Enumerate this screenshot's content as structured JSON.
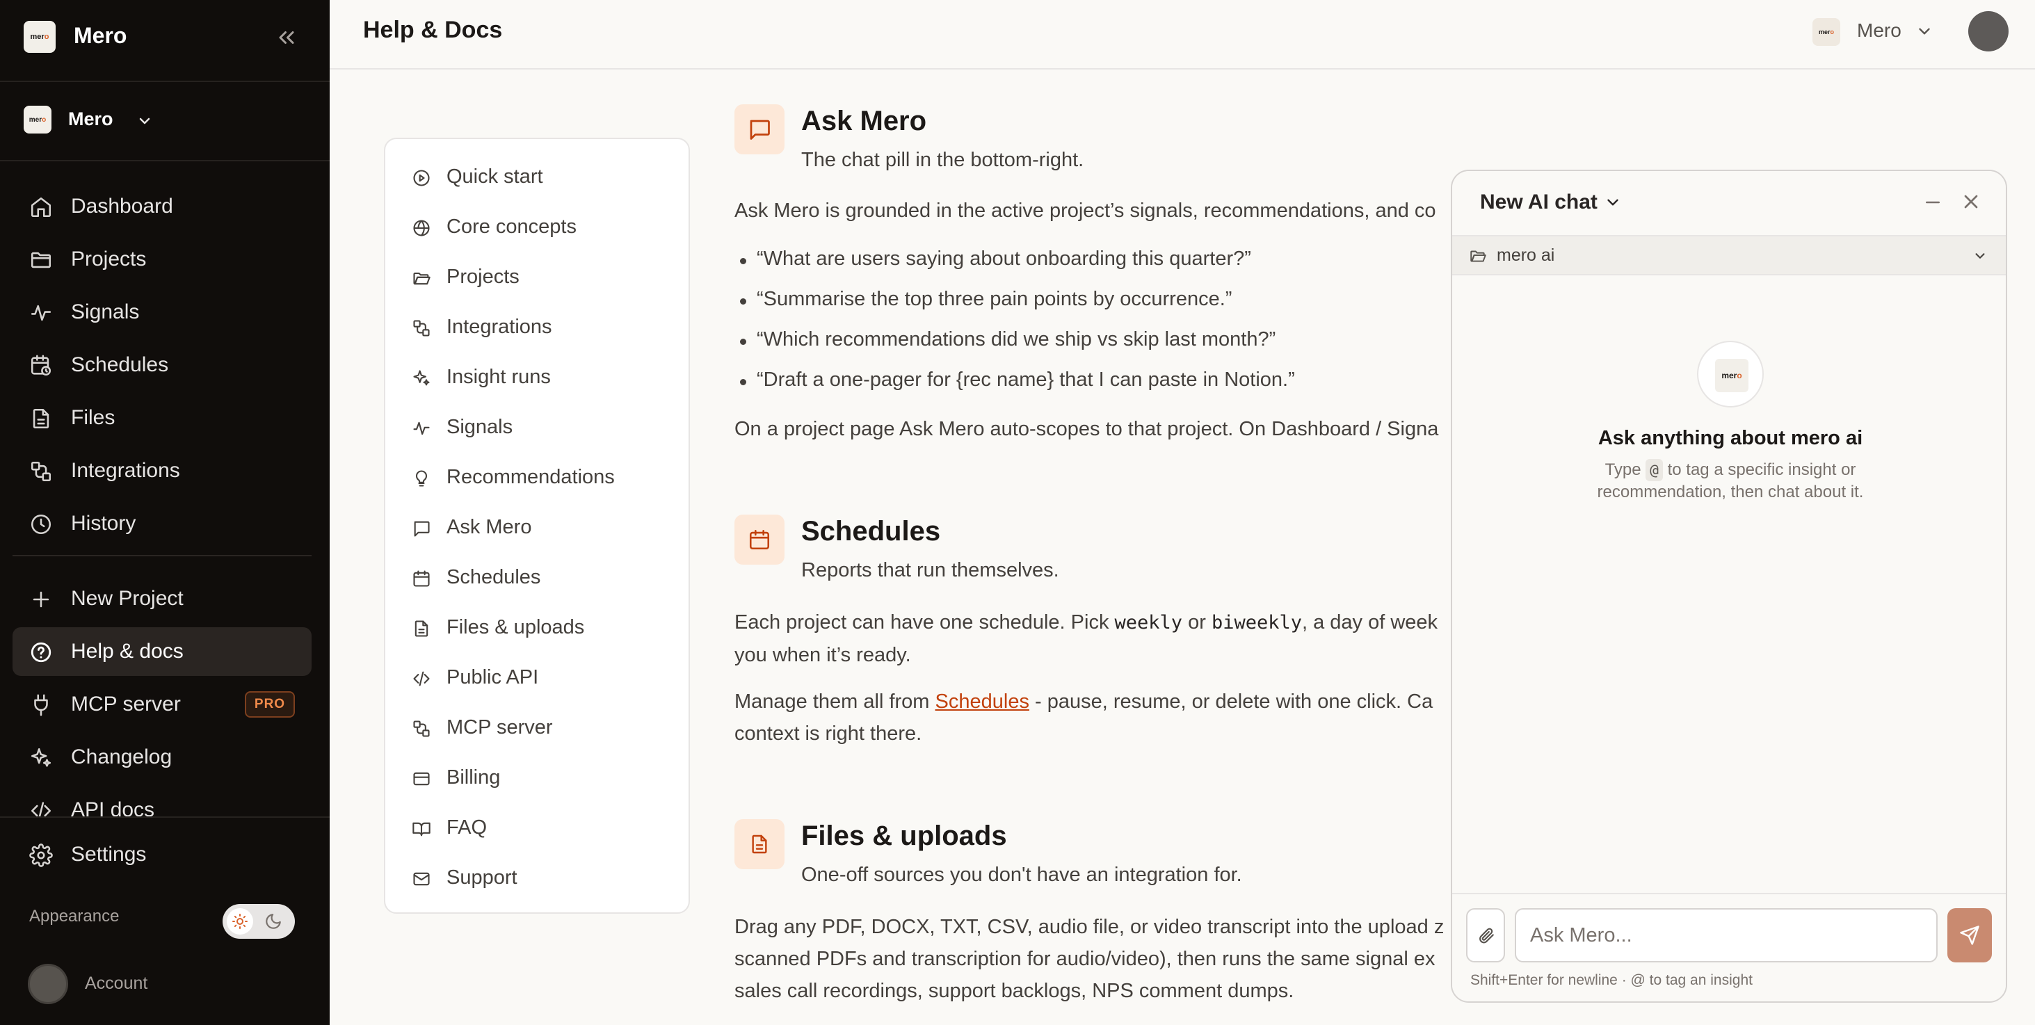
{
  "sidebar": {
    "app_title": "Mero",
    "logo_text_a": "mer",
    "logo_text_b": "o",
    "workspace": "Mero",
    "nav": [
      {
        "label": "Dashboard",
        "icon": "home-icon"
      },
      {
        "label": "Projects",
        "icon": "folder-icon"
      },
      {
        "label": "Signals",
        "icon": "activity-icon"
      },
      {
        "label": "Schedules",
        "icon": "calendar-clock-icon"
      },
      {
        "label": "Files",
        "icon": "file-icon"
      },
      {
        "label": "Integrations",
        "icon": "plug-icon"
      },
      {
        "label": "History",
        "icon": "clock-icon"
      }
    ],
    "nav2": [
      {
        "label": "New Project",
        "icon": "plus-icon"
      },
      {
        "label": "Help & docs",
        "icon": "help-circle-icon",
        "active": true
      },
      {
        "label": "MCP server",
        "icon": "plug-icon",
        "badge": "PRO"
      },
      {
        "label": "Changelog",
        "icon": "sparkles-icon"
      },
      {
        "label": "API docs",
        "icon": "code-icon"
      }
    ],
    "settings": "Settings",
    "appearance": "Appearance",
    "account": "Account"
  },
  "header": {
    "title": "Help & Docs",
    "workspace": "Mero"
  },
  "toc": [
    {
      "label": "Quick start",
      "icon": "play-circle-icon"
    },
    {
      "label": "Core concepts",
      "icon": "globe-icon"
    },
    {
      "label": "Projects",
      "icon": "folder-open-icon"
    },
    {
      "label": "Integrations",
      "icon": "plug-icon"
    },
    {
      "label": "Insight runs",
      "icon": "sparkles-icon"
    },
    {
      "label": "Signals",
      "icon": "activity-icon"
    },
    {
      "label": "Recommendations",
      "icon": "lightbulb-icon"
    },
    {
      "label": "Ask Mero",
      "icon": "message-square-icon"
    },
    {
      "label": "Schedules",
      "icon": "calendar-icon"
    },
    {
      "label": "Files & uploads",
      "icon": "file-text-icon"
    },
    {
      "label": "Public API",
      "icon": "code-icon"
    },
    {
      "label": "MCP server",
      "icon": "plug-icon"
    },
    {
      "label": "Billing",
      "icon": "credit-card-icon"
    },
    {
      "label": "FAQ",
      "icon": "book-open-icon"
    },
    {
      "label": "Support",
      "icon": "mail-icon"
    }
  ],
  "sections": {
    "ask": {
      "title": "Ask Mero",
      "subtitle": "The chat pill in the bottom-right.",
      "intro": "Ask Mero is grounded in the active project’s signals, recommendations, and co",
      "bullets": [
        "“What are users saying about onboarding this quarter?”",
        "“Summarise the top three pain points by occurrence.”",
        "“Which recommendations did we ship vs skip last month?”",
        "“Draft a one-pager for {rec name} that I can paste in Notion.”"
      ],
      "outro": "On a project page Ask Mero auto-scopes to that project. On Dashboard / Signa"
    },
    "schedules": {
      "title": "Schedules",
      "subtitle": "Reports that run themselves.",
      "p1_a": "Each project can have one schedule. Pick ",
      "p1_code1": "weekly",
      "p1_b": " or ",
      "p1_code2": "biweekly",
      "p1_c": ", a day of week",
      "p1_line2": "you when it’s ready.",
      "p2_a": "Manage them all from ",
      "p2_link": "Schedules",
      "p2_b": " - pause, resume, or delete with one click. Ca",
      "p2_line2": "context is right there."
    },
    "files": {
      "title": "Files & uploads",
      "subtitle": "One-off sources you don't have an integration for.",
      "line1": "Drag any PDF, DOCX, TXT, CSV, audio file, or video transcript into the upload z",
      "line2": "scanned PDFs and transcription for audio/video), then runs the same signal ex",
      "line3": "sales call recordings, support backlogs, NPS comment dumps."
    }
  },
  "chat": {
    "title": "New AI chat",
    "scope": "mero ai",
    "empty_title": "Ask anything about mero ai",
    "empty_sub_a": "Type ",
    "empty_sub_at": "@",
    "empty_sub_b": " to tag a specific insight or",
    "empty_sub_line2": "recommendation, then chat about it.",
    "placeholder": "Ask Mero...",
    "hint": "Shift+Enter for newline · @ to tag an insight"
  },
  "colors": {
    "sidebar_bg": "#100d0b",
    "accent": "#c2410c",
    "accent_soft": "#fde8d8",
    "page_bg": "#faf9f6"
  }
}
